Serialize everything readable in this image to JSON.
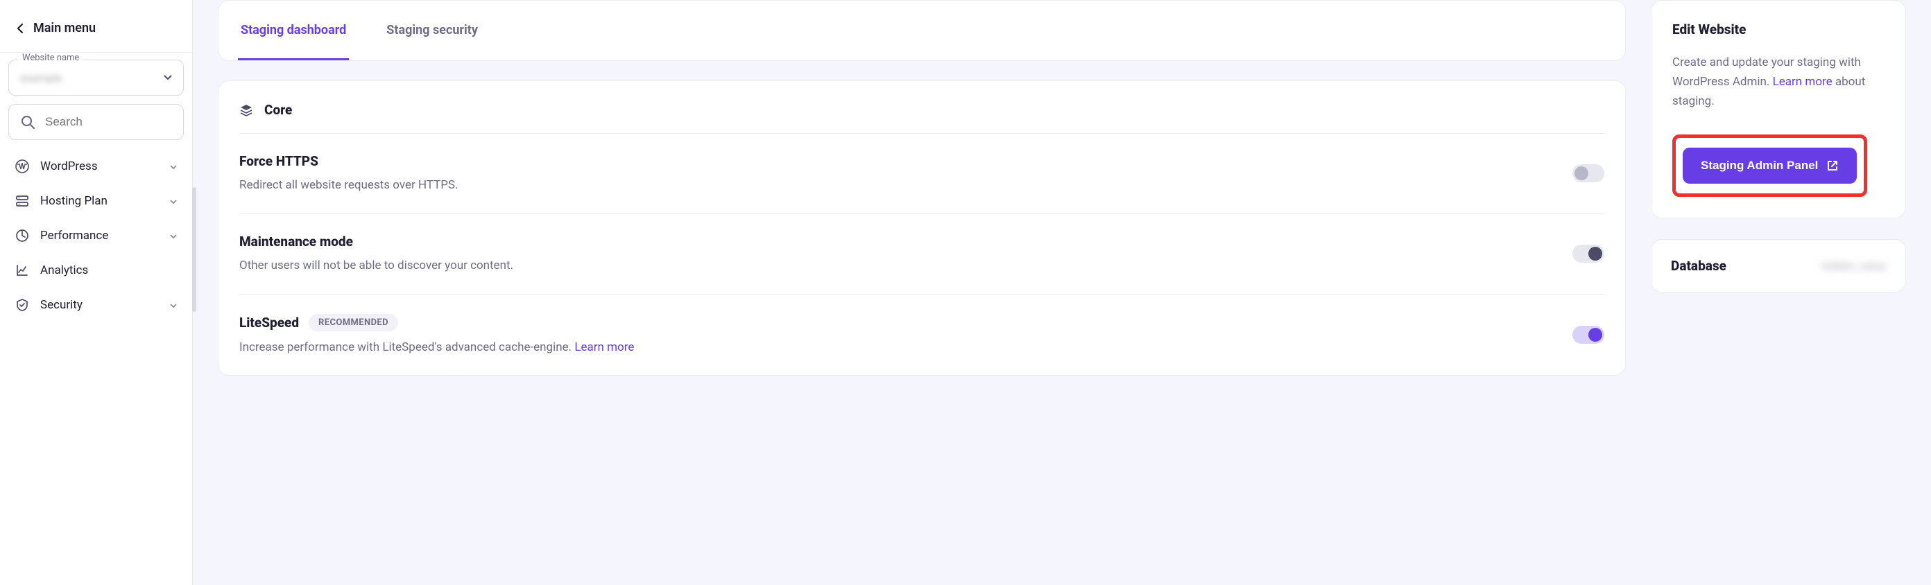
{
  "sidebar": {
    "back_label": "Main menu",
    "website_field_label": "Website name",
    "website_value": "example",
    "search_placeholder": "Search",
    "items": [
      {
        "icon": "wordpress",
        "label": "WordPress",
        "expandable": true
      },
      {
        "icon": "server",
        "label": "Hosting Plan",
        "expandable": true
      },
      {
        "icon": "gauge",
        "label": "Performance",
        "expandable": true
      },
      {
        "icon": "chart",
        "label": "Analytics",
        "expandable": false
      },
      {
        "icon": "shield",
        "label": "Security",
        "expandable": true
      }
    ]
  },
  "tabs": [
    {
      "label": "Staging dashboard",
      "active": true
    },
    {
      "label": "Staging security",
      "active": false
    }
  ],
  "core": {
    "title": "Core",
    "settings": [
      {
        "title": "Force HTTPS",
        "desc": "Redirect all website requests over HTTPS.",
        "state": "off",
        "recommended": false,
        "learn_more": ""
      },
      {
        "title": "Maintenance mode",
        "desc": "Other users will not be able to discover your content.",
        "state": "on-dark",
        "recommended": false,
        "learn_more": ""
      },
      {
        "title": "LiteSpeed",
        "desc": "Increase performance with LiteSpeed's advanced cache-engine. ",
        "state": "on",
        "recommended": true,
        "learn_more": "Learn more"
      }
    ],
    "recommended_badge": "RECOMMENDED"
  },
  "edit_panel": {
    "title": "Edit Website",
    "text_before": "Create and update your staging with WordPress Admin. ",
    "learn_more": "Learn more",
    "text_after": " about staging.",
    "button": "Staging Admin Panel"
  },
  "database": {
    "title": "Database",
    "value": "hidden_value"
  }
}
